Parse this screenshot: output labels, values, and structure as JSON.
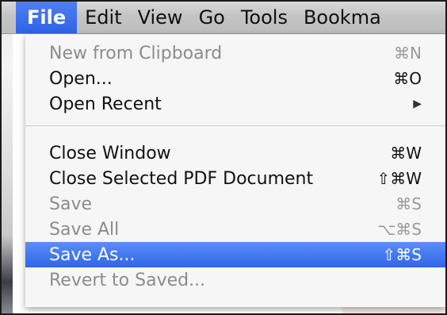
{
  "menubar": {
    "items": [
      {
        "label": "File"
      },
      {
        "label": "Edit"
      },
      {
        "label": "View"
      },
      {
        "label": "Go"
      },
      {
        "label": "Tools"
      },
      {
        "label": "Bookma"
      }
    ]
  },
  "file_menu": {
    "items": [
      {
        "label": "New from Clipboard",
        "shortcut": "⌘N"
      },
      {
        "label": "Open...",
        "shortcut": "⌘O"
      },
      {
        "label": "Open Recent",
        "submenu_icon": "▶"
      },
      {
        "label": "Close Window",
        "shortcut": "⌘W"
      },
      {
        "label": "Close Selected PDF Document",
        "shortcut": "⇧⌘W"
      },
      {
        "label": "Save",
        "shortcut": "⌘S"
      },
      {
        "label": "Save All",
        "shortcut": "⌥⌘S"
      },
      {
        "label": "Save As...",
        "shortcut": "⇧⌘S"
      },
      {
        "label": "Revert to Saved..."
      }
    ]
  },
  "colors": {
    "highlight": "#2f66ea",
    "disabled_text": "#8c8c8c"
  }
}
